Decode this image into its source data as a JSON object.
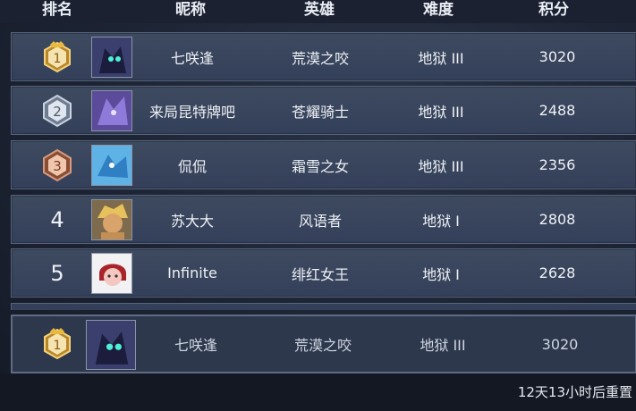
{
  "header": {
    "rank": "排名",
    "nickname": "昵称",
    "hero": "英雄",
    "difficulty": "难度",
    "score": "积分"
  },
  "rows": [
    {
      "rank": "1",
      "badge": "gold-crown-badge-icon",
      "avatar": "dark-dragon-avatar-icon",
      "name": "七咲逢",
      "hero": "荒漠之咬",
      "difficulty": "地狱 III",
      "score": "3020"
    },
    {
      "rank": "2",
      "badge": "silver-hexagon-badge-icon",
      "avatar": "purple-dragon-avatar-icon",
      "name": "来局昆特牌吧",
      "hero": "苍耀骑士",
      "difficulty": "地狱 III",
      "score": "2488"
    },
    {
      "rank": "3",
      "badge": "bronze-hexagon-badge-icon",
      "avatar": "blue-dragon-avatar-icon",
      "name": "侃侃",
      "hero": "霜雪之女",
      "difficulty": "地狱 III",
      "score": "2356"
    },
    {
      "rank": "4",
      "avatar": "blond-hero-avatar-icon",
      "name": "苏大大",
      "hero": "风语者",
      "difficulty": "地狱 I",
      "score": "2808"
    },
    {
      "rank": "5",
      "avatar": "red-hair-girl-avatar-icon",
      "name": "Infinite",
      "hero": "绯红女王",
      "difficulty": "地狱 I",
      "score": "2628"
    }
  ],
  "self_row": {
    "rank": "1",
    "badge": "gold-crown-badge-icon",
    "avatar": "dark-dragon-avatar-icon",
    "name": "七咲逢",
    "hero": "荒漠之咬",
    "difficulty": "地狱 III",
    "score": "3020"
  },
  "reset_text": "12天13小时后重置"
}
